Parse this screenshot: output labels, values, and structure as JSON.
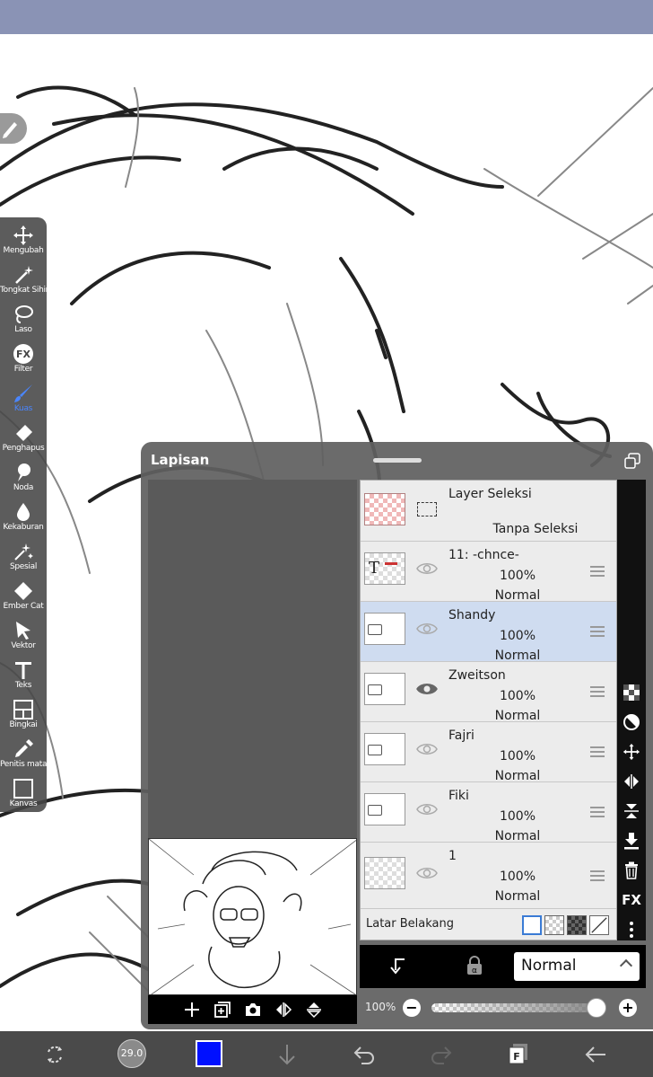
{
  "toolbar": {
    "tools": [
      {
        "label": "Mengubah",
        "icon": "move-icon"
      },
      {
        "label": "Tongkat Sihir",
        "icon": "magic-wand-icon"
      },
      {
        "label": "Laso",
        "icon": "lasso-icon"
      },
      {
        "label": "Filter",
        "icon": "fx-icon"
      },
      {
        "label": "Kuas",
        "icon": "brush-icon"
      },
      {
        "label": "Penghapus",
        "icon": "eraser-icon"
      },
      {
        "label": "Noda",
        "icon": "smudge-icon"
      },
      {
        "label": "Kekaburan",
        "icon": "blur-icon"
      },
      {
        "label": "Spesial",
        "icon": "special-icon"
      },
      {
        "label": "Ember Cat",
        "icon": "bucket-icon"
      },
      {
        "label": "Vektor",
        "icon": "vector-icon"
      },
      {
        "label": "Teks",
        "icon": "text-icon"
      },
      {
        "label": "Bingkai",
        "icon": "frame-icon"
      },
      {
        "label": "Penitis mata",
        "icon": "eyedropper-icon"
      },
      {
        "label": "Kanvas",
        "icon": "canvas-icon"
      }
    ],
    "active": "Kuas"
  },
  "layer_panel": {
    "title": "Lapisan",
    "selection_layer": {
      "name": "Layer Seleksi",
      "status": "Tanpa Seleksi"
    },
    "layers": [
      {
        "name": "11: -chnce-",
        "opacity": "100%",
        "mode": "Normal",
        "type": "text",
        "visible": false
      },
      {
        "name": "Shandy",
        "opacity": "100%",
        "mode": "Normal",
        "type": "folder",
        "visible": false,
        "selected": true
      },
      {
        "name": "Zweitson",
        "opacity": "100%",
        "mode": "Normal",
        "type": "folder",
        "visible": true
      },
      {
        "name": "Fajri",
        "opacity": "100%",
        "mode": "Normal",
        "type": "folder",
        "visible": false
      },
      {
        "name": "Fiki",
        "opacity": "100%",
        "mode": "Normal",
        "type": "folder",
        "visible": false
      },
      {
        "name": "1",
        "opacity": "100%",
        "mode": "Normal",
        "type": "raster",
        "visible": false
      }
    ],
    "background": {
      "label": "Latar Belakang"
    },
    "blend_mode": "Normal",
    "opacity_label": "100%",
    "opacity_value": 1.0,
    "text_layer_glyph": "T",
    "fx_label": "FX"
  },
  "bottombar": {
    "brush_size": "29.0",
    "color": "#0010ff"
  }
}
